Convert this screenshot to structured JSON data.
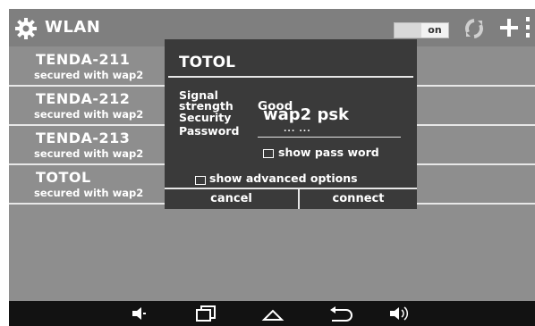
{
  "header": {
    "title": "WLAN",
    "toggle_label": "on",
    "icons": [
      "gear-icon",
      "refresh-icon",
      "plus-icon",
      "more-icon"
    ]
  },
  "networks": [
    {
      "name": "TENDA-211",
      "sub": "secured with wap2"
    },
    {
      "name": "TENDA-212",
      "sub": "secured with wap2"
    },
    {
      "name": "TENDA-213",
      "sub": "secured with wap2"
    },
    {
      "name": "TOTOL",
      "sub": "secured with wap2"
    }
  ],
  "dialog": {
    "title": "TOTOL",
    "signal_label_1": "Signal",
    "signal_label_2": "strength",
    "signal_value": "Good",
    "security_label": "Security",
    "security_value": "wap2 psk",
    "password_label": "Password",
    "password_value": "... ...",
    "show_password_label": "show pass word",
    "show_advanced_label": "show advanced options",
    "cancel_label": "cancel",
    "connect_label": "connect"
  },
  "navbar": {
    "icons": [
      "volume-down-icon",
      "recent-apps-icon",
      "home-icon",
      "back-icon",
      "volume-up-icon"
    ]
  },
  "colors": {
    "screen_bg": "#8e8e8e",
    "titlebar_bg": "#7f7f7f",
    "dialog_bg": "#3a3a3a",
    "navbar_bg": "#121212"
  }
}
